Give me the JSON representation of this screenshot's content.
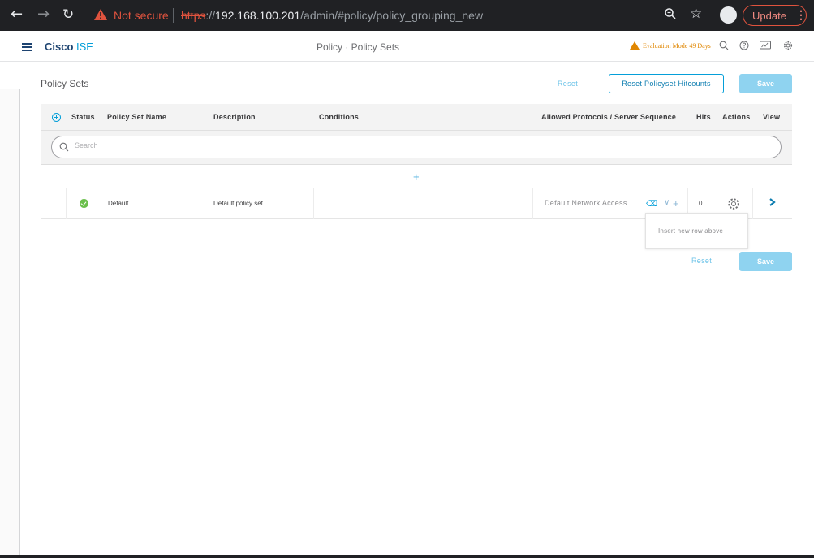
{
  "browser": {
    "security_text": "Not secure",
    "url_scheme": "https",
    "url_sep": "://",
    "url_host": "192.168.100.201",
    "url_path": "/admin/#policy/policy_grouping_new",
    "update_label": "Update"
  },
  "app": {
    "brand_bold": "Cisco",
    "brand_light": " ISE",
    "title": "Policy · Policy Sets",
    "eval_text": "Evaluation Mode 49 Days"
  },
  "page": {
    "heading": "Policy Sets",
    "reset_label": "Reset",
    "reset_hitcounts_label": "Reset Policyset Hitcounts",
    "save_label": "Save"
  },
  "table": {
    "headers": {
      "status": "Status",
      "name": "Policy Set Name",
      "description": "Description",
      "conditions": "Conditions",
      "protocols": "Allowed Protocols / Server Sequence",
      "hits": "Hits",
      "actions": "Actions",
      "view": "View"
    },
    "search_placeholder": "Search",
    "insert_symbol": "+",
    "rows": [
      {
        "status": "enabled",
        "name": "Default",
        "description": "Default policy set",
        "conditions": "",
        "protocol": "Default Network Access",
        "hits": "0"
      }
    ],
    "tooltip": "Insert new row above"
  },
  "colors": {
    "accent": "#049fd9",
    "save_disabled": "#8fd3f0",
    "status_ok": "#6abf4b",
    "warning": "#e08600"
  }
}
